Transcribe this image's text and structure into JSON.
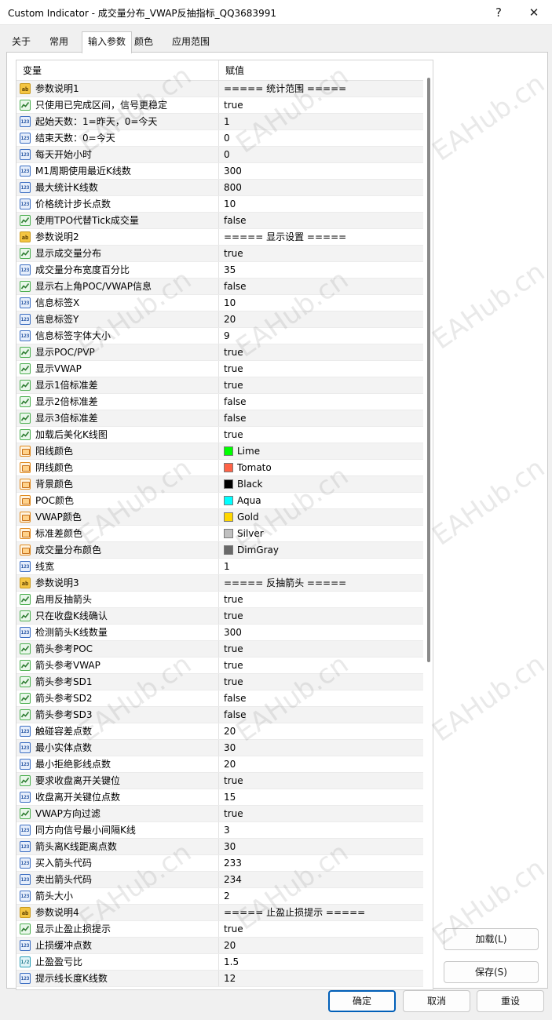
{
  "window": {
    "title": "Custom Indicator - 成交量分布_VWAP反抽指标_QQ3683991",
    "help_glyph": "?",
    "close_glyph": "✕"
  },
  "tabs": [
    {
      "label": "关于"
    },
    {
      "label": "常用"
    },
    {
      "label": "输入参数"
    },
    {
      "label": "颜色"
    },
    {
      "label": "应用范围"
    }
  ],
  "grid": {
    "col_variable": "变量",
    "col_value": "赋值"
  },
  "params": [
    {
      "type": "string",
      "icon": "ab",
      "name": "参数说明1",
      "value": "===== 统计范围 ====="
    },
    {
      "type": "bool",
      "icon": "bool",
      "name": "只使用已完成区间，信号更稳定",
      "value": "true"
    },
    {
      "type": "int",
      "icon": "123",
      "name": "起始天数：1=昨天，0=今天",
      "value": "1"
    },
    {
      "type": "int",
      "icon": "123",
      "name": "结束天数：0=今天",
      "value": "0"
    },
    {
      "type": "int",
      "icon": "123",
      "name": "每天开始小时",
      "value": "0"
    },
    {
      "type": "int",
      "icon": "123",
      "name": "M1周期使用最近K线数",
      "value": "300"
    },
    {
      "type": "int",
      "icon": "123",
      "name": "最大统计K线数",
      "value": "800"
    },
    {
      "type": "int",
      "icon": "123",
      "name": "价格统计步长点数",
      "value": "10"
    },
    {
      "type": "bool",
      "icon": "bool",
      "name": "使用TPO代替Tick成交量",
      "value": "false"
    },
    {
      "type": "string",
      "icon": "ab",
      "name": "参数说明2",
      "value": "===== 显示设置 ====="
    },
    {
      "type": "bool",
      "icon": "bool",
      "name": "显示成交量分布",
      "value": "true"
    },
    {
      "type": "int",
      "icon": "123",
      "name": "成交量分布宽度百分比",
      "value": "35"
    },
    {
      "type": "bool",
      "icon": "bool",
      "name": "显示右上角POC/VWAP信息",
      "value": "false"
    },
    {
      "type": "int",
      "icon": "123",
      "name": "信息标签X",
      "value": "10"
    },
    {
      "type": "int",
      "icon": "123",
      "name": "信息标签Y",
      "value": "20"
    },
    {
      "type": "int",
      "icon": "123",
      "name": "信息标签字体大小",
      "value": "9"
    },
    {
      "type": "bool",
      "icon": "bool",
      "name": "显示POC/PVP",
      "value": "true"
    },
    {
      "type": "bool",
      "icon": "bool",
      "name": "显示VWAP",
      "value": "true"
    },
    {
      "type": "bool",
      "icon": "bool",
      "name": "显示1倍标准差",
      "value": "true"
    },
    {
      "type": "bool",
      "icon": "bool",
      "name": "显示2倍标准差",
      "value": "false"
    },
    {
      "type": "bool",
      "icon": "bool",
      "name": "显示3倍标准差",
      "value": "false"
    },
    {
      "type": "bool",
      "icon": "bool",
      "name": "加载后美化K线图",
      "value": "true"
    },
    {
      "type": "color",
      "icon": "color",
      "name": "阳线颜色",
      "value": "Lime",
      "color": "#00ff00"
    },
    {
      "type": "color",
      "icon": "color",
      "name": "阴线颜色",
      "value": "Tomato",
      "color": "#ff6347"
    },
    {
      "type": "color",
      "icon": "color",
      "name": "背景颜色",
      "value": "Black",
      "color": "#000000"
    },
    {
      "type": "color",
      "icon": "color",
      "name": "POC颜色",
      "value": "Aqua",
      "color": "#00ffff"
    },
    {
      "type": "color",
      "icon": "color",
      "name": "VWAP颜色",
      "value": "Gold",
      "color": "#ffd700"
    },
    {
      "type": "color",
      "icon": "color",
      "name": "标准差颜色",
      "value": "Silver",
      "color": "#c0c0c0"
    },
    {
      "type": "color",
      "icon": "color",
      "name": "成交量分布颜色",
      "value": "DimGray",
      "color": "#696969"
    },
    {
      "type": "int",
      "icon": "123",
      "name": "线宽",
      "value": "1"
    },
    {
      "type": "string",
      "icon": "ab",
      "name": "参数说明3",
      "value": "===== 反抽箭头 ====="
    },
    {
      "type": "bool",
      "icon": "bool",
      "name": "启用反抽箭头",
      "value": "true"
    },
    {
      "type": "bool",
      "icon": "bool",
      "name": "只在收盘K线确认",
      "value": "true"
    },
    {
      "type": "int",
      "icon": "123",
      "name": "检测箭头K线数量",
      "value": "300"
    },
    {
      "type": "bool",
      "icon": "bool",
      "name": "箭头参考POC",
      "value": "true"
    },
    {
      "type": "bool",
      "icon": "bool",
      "name": "箭头参考VWAP",
      "value": "true"
    },
    {
      "type": "bool",
      "icon": "bool",
      "name": "箭头参考SD1",
      "value": "true"
    },
    {
      "type": "bool",
      "icon": "bool",
      "name": "箭头参考SD2",
      "value": "false"
    },
    {
      "type": "bool",
      "icon": "bool",
      "name": "箭头参考SD3",
      "value": "false"
    },
    {
      "type": "int",
      "icon": "123",
      "name": "触碰容差点数",
      "value": "20"
    },
    {
      "type": "int",
      "icon": "123",
      "name": "最小实体点数",
      "value": "30"
    },
    {
      "type": "int",
      "icon": "123",
      "name": "最小拒绝影线点数",
      "value": "20"
    },
    {
      "type": "bool",
      "icon": "bool",
      "name": "要求收盘离开关键位",
      "value": "true"
    },
    {
      "type": "int",
      "icon": "123",
      "name": "收盘离开关键位点数",
      "value": "15"
    },
    {
      "type": "bool",
      "icon": "bool",
      "name": "VWAP方向过滤",
      "value": "true"
    },
    {
      "type": "int",
      "icon": "123",
      "name": "同方向信号最小间隔K线",
      "value": "3"
    },
    {
      "type": "int",
      "icon": "123",
      "name": "箭头离K线距离点数",
      "value": "30"
    },
    {
      "type": "int",
      "icon": "123",
      "name": "买入箭头代码",
      "value": "233"
    },
    {
      "type": "int",
      "icon": "123",
      "name": "卖出箭头代码",
      "value": "234"
    },
    {
      "type": "int",
      "icon": "123",
      "name": "箭头大小",
      "value": "2"
    },
    {
      "type": "string",
      "icon": "ab",
      "name": "参数说明4",
      "value": "===== 止盈止损提示 ====="
    },
    {
      "type": "bool",
      "icon": "bool",
      "name": "显示止盈止损提示",
      "value": "true"
    },
    {
      "type": "int",
      "icon": "123",
      "name": "止损缓冲点数",
      "value": "20"
    },
    {
      "type": "double",
      "icon": "1/2",
      "name": "止盈盈亏比",
      "value": "1.5"
    },
    {
      "type": "int",
      "icon": "123",
      "name": "提示线长度K线数",
      "value": "12"
    }
  ],
  "side_buttons": {
    "load": "加载(L)",
    "save": "保存(S)"
  },
  "bottom_buttons": {
    "ok": "确定",
    "cancel": "取消",
    "reset": "重设"
  },
  "watermark": "EAHub.cn"
}
